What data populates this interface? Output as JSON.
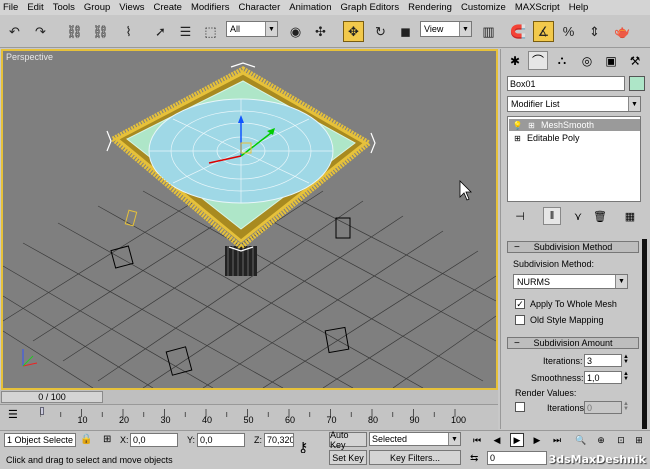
{
  "menu": [
    "File",
    "Edit",
    "Tools",
    "Group",
    "Views",
    "Create",
    "Modifiers",
    "Character",
    "Animation",
    "Graph Editors",
    "Rendering",
    "Customize",
    "MAXScript",
    "Help"
  ],
  "toolbar": {
    "selection_filter": "All",
    "reference_coord": "View"
  },
  "viewport": {
    "label": "Perspective"
  },
  "timeline": {
    "frame_display": "0 / 100",
    "ticks": [
      "10",
      "20",
      "30",
      "40",
      "50",
      "60",
      "70",
      "80",
      "90",
      "100"
    ]
  },
  "command_panel": {
    "object_name": "Box01",
    "object_color": "#aee6c8",
    "modifier_list": "Modifier List",
    "stack": [
      {
        "label": "MeshSmooth",
        "selected": true
      },
      {
        "label": "Editable Poly",
        "selected": false
      }
    ],
    "rollouts": {
      "subdivision_method": {
        "title": "Subdivision Method",
        "method_label": "Subdivision Method:",
        "method_value": "NURMS",
        "apply_whole_mesh": "Apply To Whole Mesh",
        "old_style": "Old Style Mapping"
      },
      "subdivision_amount": {
        "title": "Subdivision Amount",
        "iterations_label": "Iterations:",
        "iterations_value": "3",
        "smoothness_label": "Smoothness:",
        "smoothness_value": "1,0",
        "render_values_label": "Render Values:",
        "render_iterations_label": "Iterations:",
        "render_iterations_value": "0"
      }
    }
  },
  "status": {
    "selected_count": "1 Object Selecte",
    "prompt": "Click and drag to select and move objects",
    "x_label": "X:",
    "x_value": "0,0",
    "y_label": "Y:",
    "y_value": "0,0",
    "z_label": "Z:",
    "z_value": "70,320",
    "auto_key": "Auto Key",
    "set_key": "Set Key",
    "key_mode": "Selected",
    "key_filters": "Key Filters...",
    "current_frame": "0"
  },
  "watermark": "3dsMaxDeshnik",
  "colors": {
    "selection_bracket": "#e6c13a",
    "viewport_bg": "#7f7f7f",
    "mesh_top": "#aee6c8",
    "dome": "#9fd8e6"
  }
}
